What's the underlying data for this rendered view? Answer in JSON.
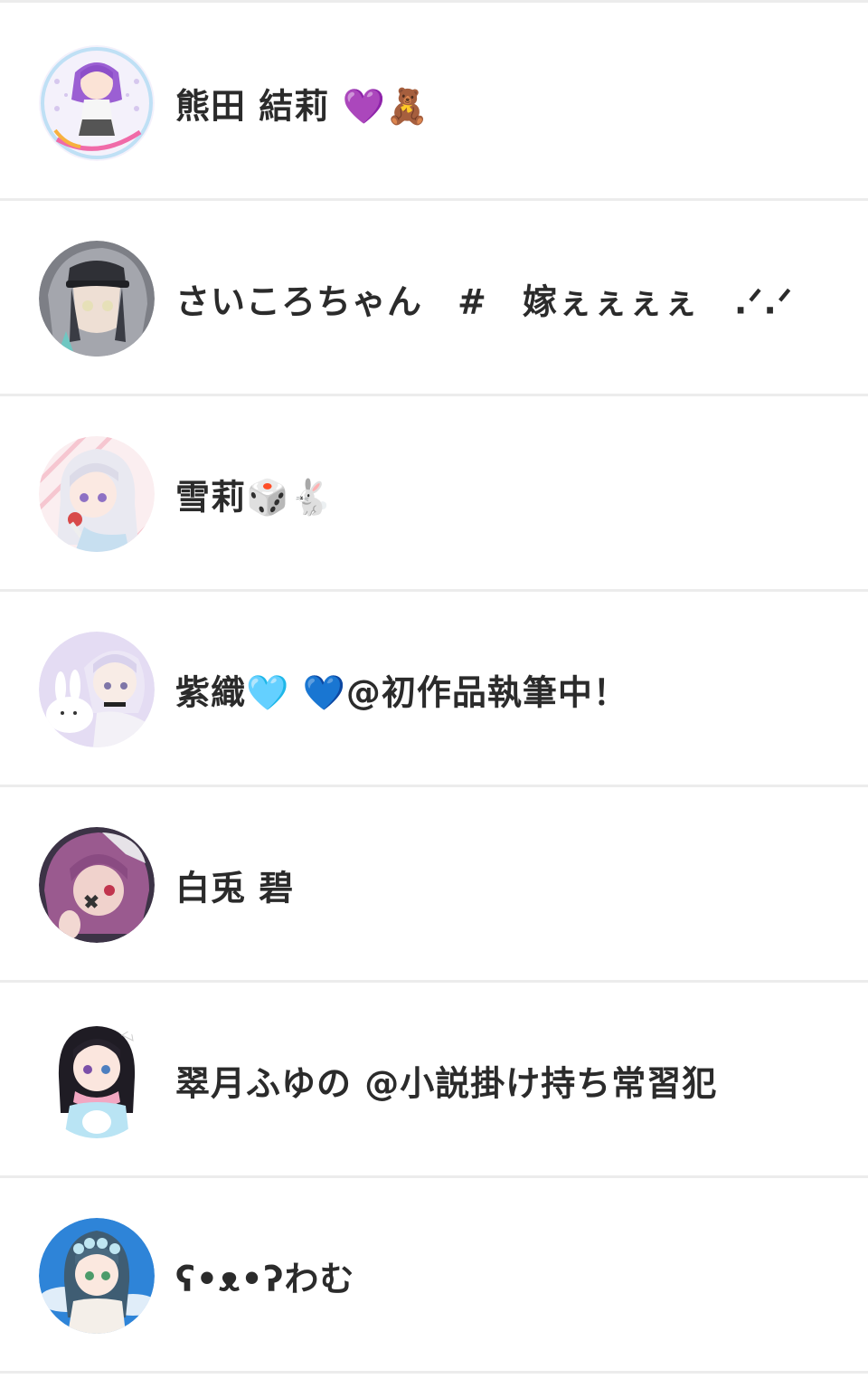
{
  "users": [
    {
      "name": "熊田 結莉 💜🧸",
      "avatar_icon": "anime-girl-purple-twintails-badge-icon"
    },
    {
      "name": "さいころちゃん　#　嫁ぇぇぇぇ　.ᐟ.ᐟ",
      "avatar_icon": "anime-boy-grey-hood-cap-icon"
    },
    {
      "name": "雪莉🎲🐇",
      "avatar_icon": "anime-girl-white-hair-icon"
    },
    {
      "name": "紫織🩵 💙@初作品執筆中！",
      "avatar_icon": "anime-girl-lavender-hair-bunny-icon"
    },
    {
      "name": "白兎 碧",
      "avatar_icon": "anime-boy-purple-hair-icon"
    },
    {
      "name": "翠月ふゆの @小説掛け持ち常習犯",
      "avatar_icon": "anime-girl-black-hair-scarf-icon"
    },
    {
      "name": "ʕ•ᴥ•ʔわむ",
      "avatar_icon": "anime-girl-flower-crown-sky-icon"
    }
  ],
  "colors": {
    "divider": "#ececec",
    "text": "#2b2b2b",
    "background": "#ffffff"
  }
}
